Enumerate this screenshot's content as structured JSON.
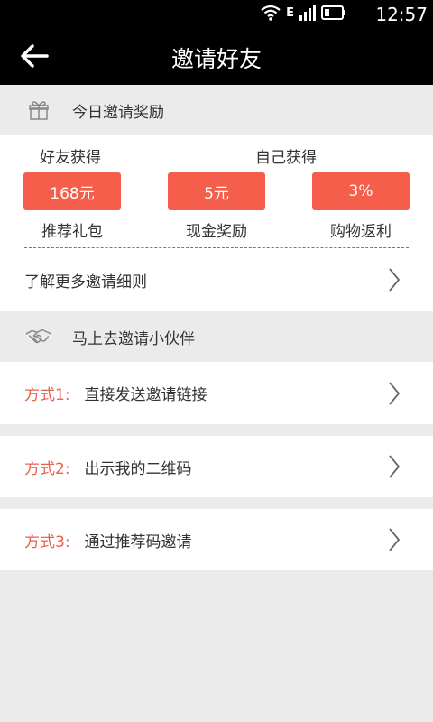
{
  "status_bar": {
    "time": "12:57",
    "network_label": "E"
  },
  "header": {
    "title": "邀请好友"
  },
  "today_reward": {
    "section_title": "今日邀请奖励",
    "friend_heading": "好友获得",
    "self_heading": "自己获得",
    "rewards": [
      {
        "value": "168元",
        "label": "推荐礼包"
      },
      {
        "value": "5元",
        "label": "现金奖励"
      },
      {
        "value": "3%",
        "label": "购物返利"
      }
    ],
    "more_rules": "了解更多邀请细则"
  },
  "invite": {
    "section_title": "马上去邀请小伙伴",
    "methods": [
      {
        "prefix": "方式1:",
        "text": "直接发送邀请链接"
      },
      {
        "prefix": "方式2:",
        "text": "出示我的二维码"
      },
      {
        "prefix": "方式3:",
        "text": "通过推荐码邀请"
      }
    ]
  },
  "colors": {
    "accent": "#f45e4b",
    "method_prefix": "#e8614d",
    "background": "#ebebeb",
    "bar": "#000000"
  }
}
